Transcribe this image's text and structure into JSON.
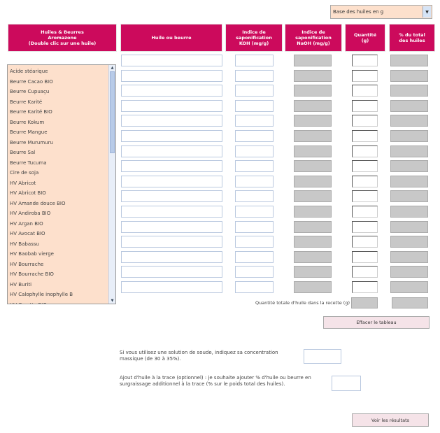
{
  "top_select": {
    "value": "Base des huiles en g"
  },
  "headers": {
    "col1": "Huiles & Beurres\nAromazone\n(Double clic sur une huile)",
    "col2": "Huile ou beurre",
    "col3": "Indice de\nsaponification\nKOH (mg/g)",
    "col4": "Indice de\nsaponification\nNaOH (mg/g)",
    "col5": "Quantité\n(g)",
    "col6": "% du total\ndes huiles"
  },
  "oils": [
    "Acide stéarique",
    "Beurre Cacao BIO",
    "Beurre Cupuaçu",
    "Beurre Karité",
    "Beurre Karité BIO",
    "Beurre Kokum",
    "Beurre Mangue",
    "Beurre Murumuru",
    "Beurre Sal",
    "Beurre Tucuma",
    "Cire de soja",
    "HV Abricot",
    "HV Abricot BIO",
    "HV Amande douce BIO",
    "HV Andiroba BIO",
    "HV Argan BIO",
    "HV Avocat BIO",
    "HV Babassu",
    "HV Baobab vierge",
    "HV Bourrache",
    "HV Bourrache BIO",
    "HV Buriti",
    "HV Calophylle inophylle B",
    "HV Carotte BIO"
  ],
  "total_label": "Quantité totale d'huile dans la recette (g)",
  "clear_button": "Effacer le tableau",
  "soda_text": "Si vous utilisez une solution de soude, indiquez sa concentration massique (de 30 à 35%).",
  "superfat_text": "Ajout d'huile à la trace (optionnel) : je souhaite ajouter % d'huile ou beurre en surgraissage additionnel à la trace (% sur le poids total des huiles).",
  "results_button": "Voir les résultats"
}
